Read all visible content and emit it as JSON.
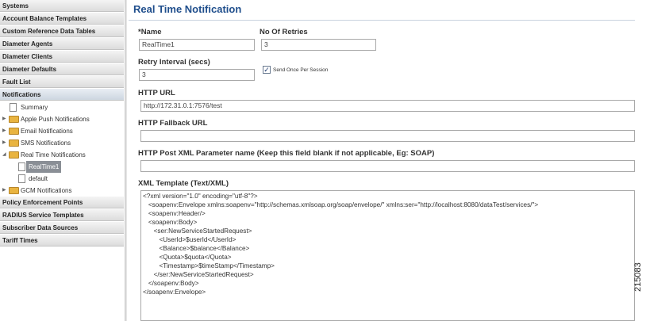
{
  "sidebar": {
    "sections_top": [
      "Systems",
      "Account Balance Templates",
      "Custom Reference Data Tables",
      "Diameter Agents",
      "Diameter Clients",
      "Diameter Defaults",
      "Fault List"
    ],
    "active_section": "Notifications",
    "tree": {
      "summary": "Summary",
      "apple_push": "Apple Push Notifications",
      "email": "Email Notifications",
      "sms": "SMS Notifications",
      "real_time": "Real Time Notifications",
      "realtime1": "RealTime1",
      "default": "default",
      "gcm": "GCM Notifications"
    },
    "sections_bottom": [
      "Policy Enforcement Points",
      "RADIUS Service Templates",
      "Subscriber Data Sources",
      "Tariff Times"
    ]
  },
  "form": {
    "title": "Real Time Notification",
    "name_label": "*Name",
    "name_value": "RealTime1",
    "retries_label": "No Of Retries",
    "retries_value": "3",
    "retry_interval_label": "Retry Interval (secs)",
    "retry_interval_value": "3",
    "send_once_label": "Send Once Per Session",
    "send_once_checked": true,
    "http_url_label": "HTTP URL",
    "http_url_value": "http://172.31.0.1:7576/test",
    "fallback_label": "HTTP Fallback URL",
    "fallback_value": "",
    "post_param_label": "HTTP Post XML Parameter name (Keep this field blank if not applicable, Eg: SOAP)",
    "post_param_value": "",
    "xml_label": "XML Template (Text/XML)",
    "xml_lines": [
      "<?xml version=\"1.0\" encoding=\"utf-8\"?>",
      "   <soapenv:Envelope xmlns:soapenv=\"http://schemas.xmlsoap.org/soap/envelope/\" xmlns:ser=\"http://localhost:8080/dataTest/services/\">",
      "   <soapenv:Header/>",
      "   <soapenv:Body>",
      "      <ser:NewServiceStartedRequest>",
      "         <UserId>$userId</UserId>",
      "         <Balance>$balance</Balance>",
      "         <Quota>$quota</Quota>",
      "         <Timestamp>$timeStamp</Timestamp>",
      "      </ser:NewServiceStartedRequest>",
      "   </soapenv:Body>",
      "</soapenv:Envelope>"
    ]
  },
  "figure_number": "215083"
}
